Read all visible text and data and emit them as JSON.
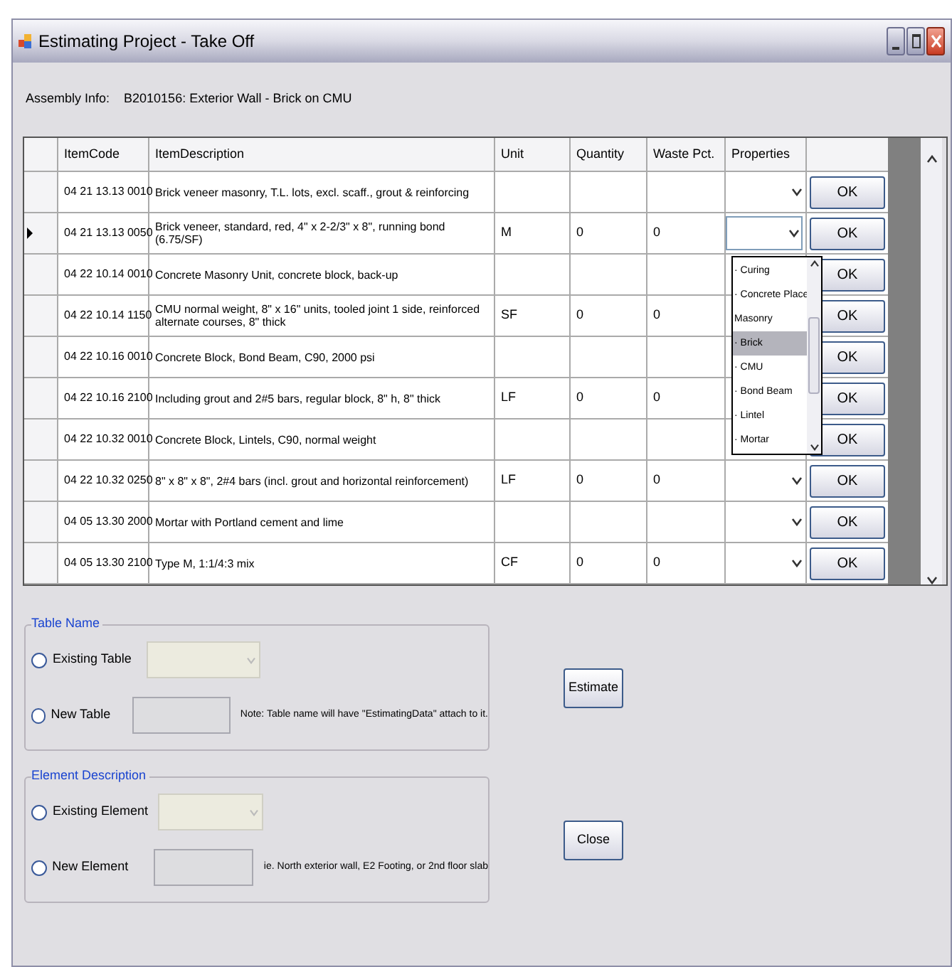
{
  "window": {
    "title": "Estimating Project - Take Off"
  },
  "assembly_info": {
    "label": "Assembly Info:",
    "value": "B2010156: Exterior Wall - Brick on CMU"
  },
  "grid": {
    "columns": [
      "ItemCode",
      "ItemDescription",
      "Unit",
      "Quantity",
      "Waste Pct.",
      "Properties"
    ],
    "rows": [
      {
        "code": "04 21 13.13 0010",
        "description": "Brick veneer masonry, T.L. lots, excl. scaff., grout & reinforcing",
        "unit": "",
        "quantity": "",
        "waste": "",
        "button": "OK",
        "current": false
      },
      {
        "code": "04 21 13.13 0050",
        "description": "Brick veneer, standard, red, 4\" x 2-2/3\" x 8\", running bond (6.75/SF)",
        "unit": "M",
        "quantity": "0",
        "waste": "0",
        "button": "OK",
        "current": true
      },
      {
        "code": "04 22 10.14 0010",
        "description": "Concrete Masonry Unit, concrete block, back-up",
        "unit": "",
        "quantity": "",
        "waste": "",
        "button": "OK",
        "current": false
      },
      {
        "code": "04 22 10.14 1150",
        "description": "CMU normal weight, 8\" x 16\" units, tooled joint 1 side, reinforced alternate courses, 8\" thick",
        "unit": "SF",
        "quantity": "0",
        "waste": "0",
        "button": "OK",
        "current": false
      },
      {
        "code": "04 22 10.16 0010",
        "description": "Concrete Block, Bond Beam, C90, 2000 psi",
        "unit": "",
        "quantity": "",
        "waste": "",
        "button": "OK",
        "current": false
      },
      {
        "code": "04 22 10.16 2100",
        "description": "Including grout and 2#5 bars, regular block, 8\" h, 8\" thick",
        "unit": "LF",
        "quantity": "0",
        "waste": "0",
        "button": "OK",
        "current": false
      },
      {
        "code": "04 22 10.32 0010",
        "description": "Concrete Block, Lintels, C90, normal weight",
        "unit": "",
        "quantity": "",
        "waste": "",
        "button": "OK",
        "current": false
      },
      {
        "code": "04 22 10.32 0250",
        "description": "8\" x 8\" x 8\", 2#4 bars (incl. grout and horizontal reinforcement)",
        "unit": "LF",
        "quantity": "0",
        "waste": "0",
        "button": "OK",
        "current": false
      },
      {
        "code": "04 05 13.30 2000",
        "description": "Mortar with Portland cement and lime",
        "unit": "",
        "quantity": "",
        "waste": "",
        "button": "OK",
        "current": false
      },
      {
        "code": "04 05 13.30 2100",
        "description": "Type M, 1:1/4:3 mix",
        "unit": "CF",
        "quantity": "0",
        "waste": "0",
        "button": "OK",
        "current": false
      }
    ],
    "properties_list": [
      {
        "label": "· Curing",
        "selected": false
      },
      {
        "label": "· Concrete Place",
        "selected": false
      },
      {
        "label": "Masonry",
        "selected": false
      },
      {
        "label": "· Brick",
        "selected": true
      },
      {
        "label": "· CMU",
        "selected": false
      },
      {
        "label": "· Bond Beam",
        "selected": false
      },
      {
        "label": "· Lintel",
        "selected": false
      },
      {
        "label": "· Mortar",
        "selected": false
      }
    ]
  },
  "groups": [
    {
      "title": "Table Name",
      "options": [
        {
          "kind": "dropdown",
          "label": "Existing Table",
          "selected": false,
          "disabled": true
        },
        {
          "kind": "text",
          "label": "New Table",
          "selected": false,
          "disabled": true,
          "note": "Note: Table name will have \"EstimatingData\" attach to it."
        }
      ],
      "button": "Estimate"
    },
    {
      "title": "Element Description",
      "options": [
        {
          "kind": "dropdown",
          "label": "Existing Element",
          "selected": false,
          "disabled": true
        },
        {
          "kind": "text",
          "label": "New Element",
          "selected": false,
          "disabled": true,
          "note": "ie. North exterior wall, E2 Footing, or 2nd floor slab"
        }
      ],
      "button": "Close"
    }
  ]
}
